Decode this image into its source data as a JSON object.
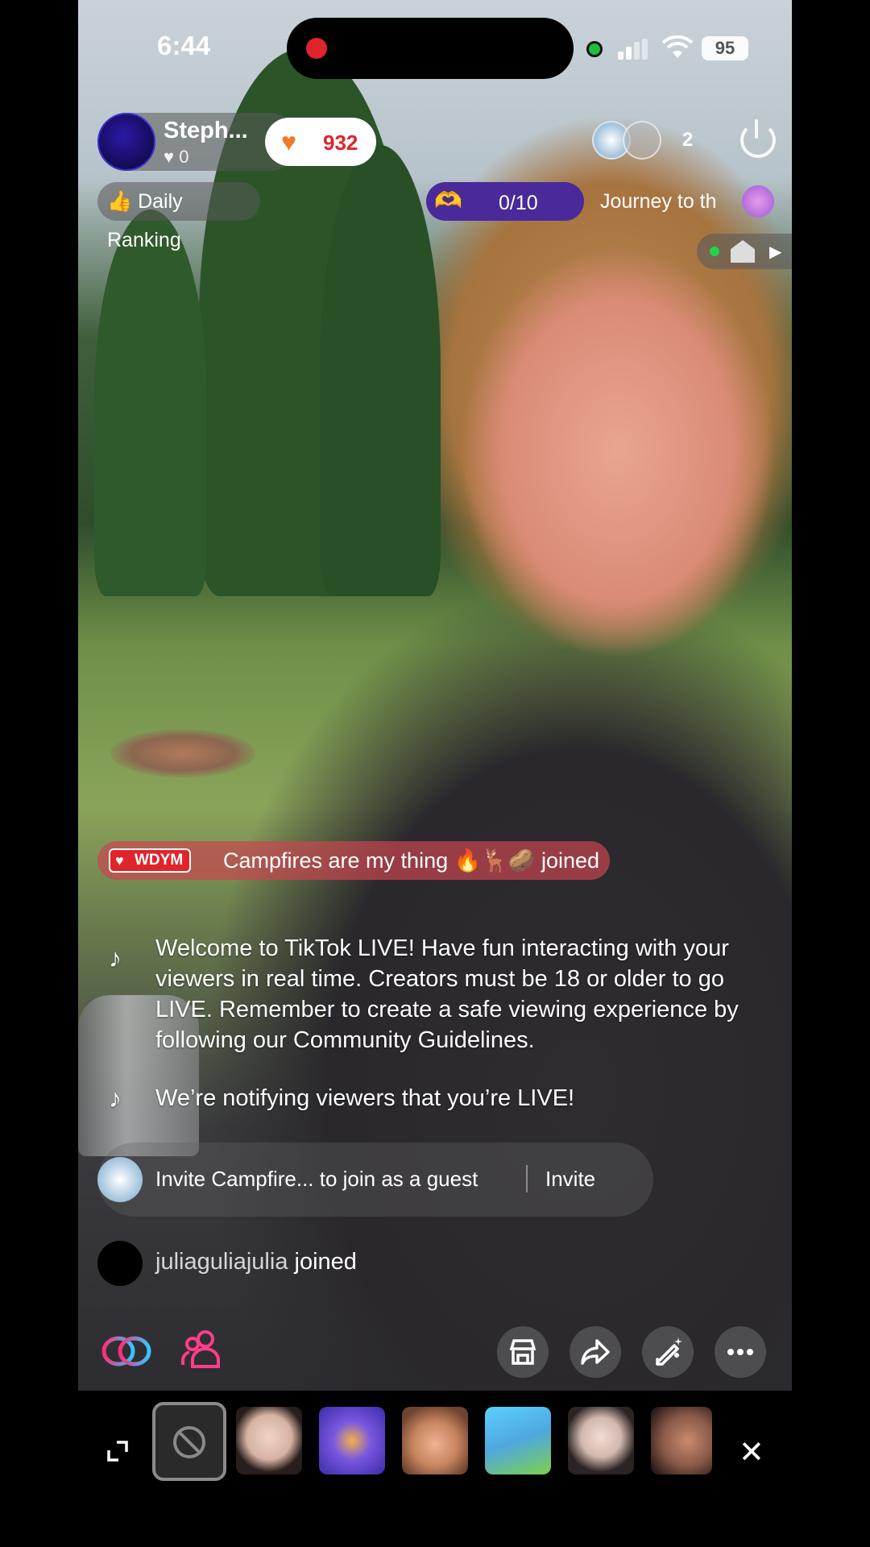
{
  "status_bar": {
    "time": "6:44",
    "battery": "95"
  },
  "host": {
    "name": "Steph...",
    "likes": "0"
  },
  "coins": {
    "value": "932"
  },
  "viewers": {
    "count": "2"
  },
  "badges": {
    "daily_ranking": "Daily Ranking",
    "goal": "0/10",
    "journey": "Journey to th"
  },
  "chat": {
    "joined_banner": {
      "badge": "WDYM",
      "text": "Campfires are my thing 🔥🦌🥔 joined"
    },
    "welcome": "Welcome to TikTok LIVE! Have fun interacting with your viewers in real time. Creators must be 18 or older to go LIVE. Remember to create a safe viewing experience by following our Community Guidelines.",
    "notifying": "We’re notifying viewers that you’re LIVE!",
    "invite": {
      "text": "Invite Campfire... to join as a guest",
      "button": "Invite"
    },
    "join": {
      "user": "juliaguliajulia",
      "action": "joined"
    }
  },
  "colors": {
    "accent": "#e0242c",
    "goal_bg": "#4a2a9a",
    "pink_icons": "#ff3d8a"
  },
  "icons": {
    "toolbar": [
      "links-icon",
      "people-icon",
      "shop-icon",
      "share-icon",
      "magic-pen-icon",
      "more-icon"
    ],
    "tray": [
      "expand-icon",
      "no-effect-icon",
      "close-icon"
    ]
  }
}
